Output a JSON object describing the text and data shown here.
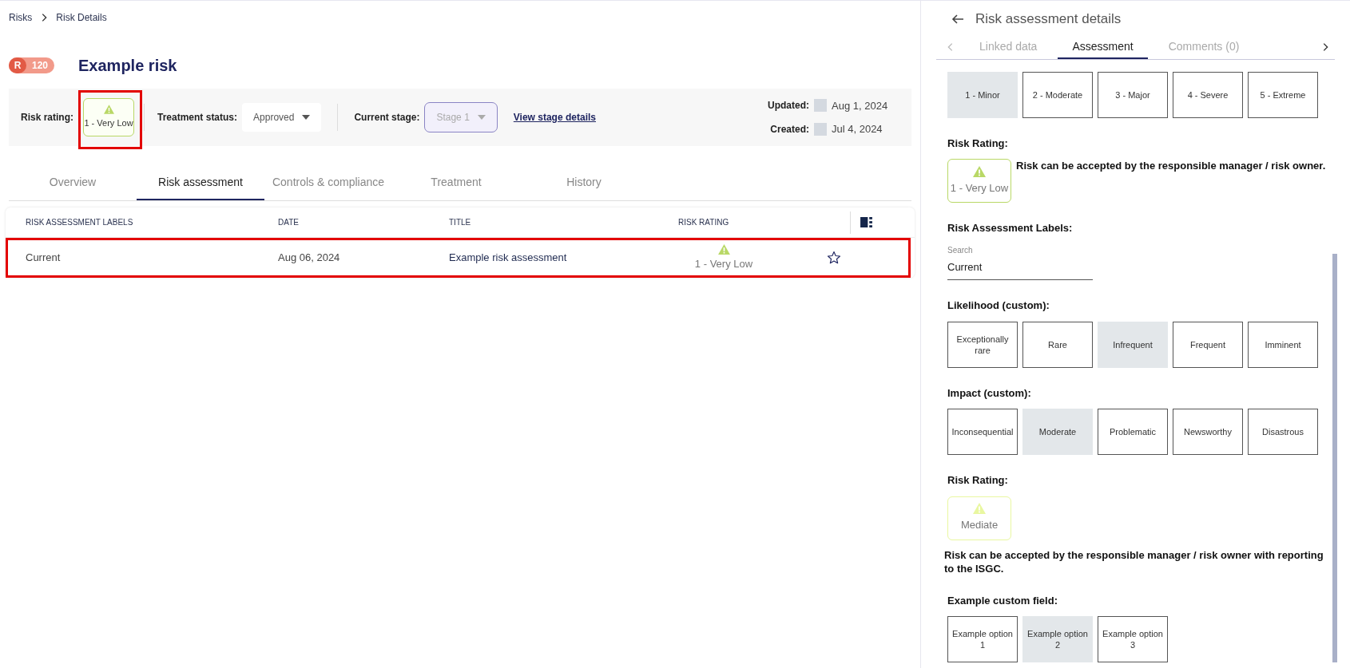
{
  "breadcrumb": [
    {
      "label": "Risks"
    },
    {
      "label": "Risk Details"
    }
  ],
  "risk": {
    "prefix": "R",
    "number": "120",
    "title": "Example risk"
  },
  "info": {
    "risk_rating": {
      "label": "Risk rating:",
      "value": "1 - Very Low",
      "color": "#b9d866",
      "highlighted": true
    },
    "treatment": {
      "label": "Treatment status:",
      "value": "Approved"
    },
    "stage": {
      "label": "Current stage:",
      "value": "Stage 1",
      "disabled": true
    },
    "stage_link": "View stage details",
    "dates": [
      {
        "label": "Updated:",
        "value": "Aug 1, 2024"
      },
      {
        "label": "Created:",
        "value": "Jul 4, 2024"
      }
    ]
  },
  "tabs": [
    {
      "label": "Overview",
      "selected": false
    },
    {
      "label": "Risk assessment",
      "selected": true
    },
    {
      "label": "Controls & compliance",
      "selected": false
    },
    {
      "label": "Treatment",
      "selected": false
    },
    {
      "label": "History",
      "selected": false
    }
  ],
  "table": {
    "columns": [
      "RISK ASSESSMENT LABELS",
      "DATE",
      "TITLE",
      "RISK RATING"
    ],
    "rows": [
      {
        "label": "Current",
        "date": "Aug 06, 2024",
        "title": "Example risk assessment",
        "rating": "1 - Very Low",
        "color": "#b9d866",
        "starred": false,
        "highlighted": true
      }
    ]
  },
  "panel": {
    "title": "Risk assessment details",
    "tabs": [
      {
        "label": "Linked data",
        "selected": false
      },
      {
        "label": "Assessment",
        "selected": true
      },
      {
        "label": "Comments (0)",
        "selected": false
      }
    ],
    "sections": [
      {
        "kind": "options",
        "options": [
          {
            "label": "1 - Minor",
            "selected": true
          },
          {
            "label": "2 - Moderate",
            "selected": false
          },
          {
            "label": "3 - Major",
            "selected": false
          },
          {
            "label": "4 - Severe",
            "selected": false
          },
          {
            "label": "5 - Extreme",
            "selected": false
          }
        ]
      },
      {
        "kind": "rating",
        "label": "Risk Rating:",
        "value": "1 - Very Low",
        "color": "#b9d866",
        "description": "Risk can be accepted by the responsible manager / risk owner.",
        "description_inline": true
      },
      {
        "kind": "search",
        "label": "Risk Assessment Labels:",
        "field_label": "Search",
        "value": "Current"
      },
      {
        "kind": "options",
        "label": "Likelihood (custom):",
        "options": [
          {
            "label": "Exceptionally rare",
            "selected": false
          },
          {
            "label": "Rare",
            "selected": false
          },
          {
            "label": "Infrequent",
            "selected": true
          },
          {
            "label": "Frequent",
            "selected": false
          },
          {
            "label": "Imminent",
            "selected": false
          }
        ]
      },
      {
        "kind": "options",
        "label": "Impact (custom):",
        "options": [
          {
            "label": "Inconsequential",
            "selected": false
          },
          {
            "label": "Moderate",
            "selected": true
          },
          {
            "label": "Problematic",
            "selected": false
          },
          {
            "label": "Newsworthy",
            "selected": false
          },
          {
            "label": "Disastrous",
            "selected": false
          }
        ]
      },
      {
        "kind": "rating",
        "label": "Risk Rating:",
        "value": "Mediate",
        "color": "#e9f7a0",
        "description": "Risk can be accepted by the responsible manager / risk owner with reporting to the ISGC.",
        "description_inline": false
      },
      {
        "kind": "options",
        "label": "Example custom field:",
        "options": [
          {
            "label": "Example option 1",
            "selected": false
          },
          {
            "label": "Example option 2",
            "selected": true
          },
          {
            "label": "Example option 3",
            "selected": false
          }
        ]
      }
    ]
  }
}
